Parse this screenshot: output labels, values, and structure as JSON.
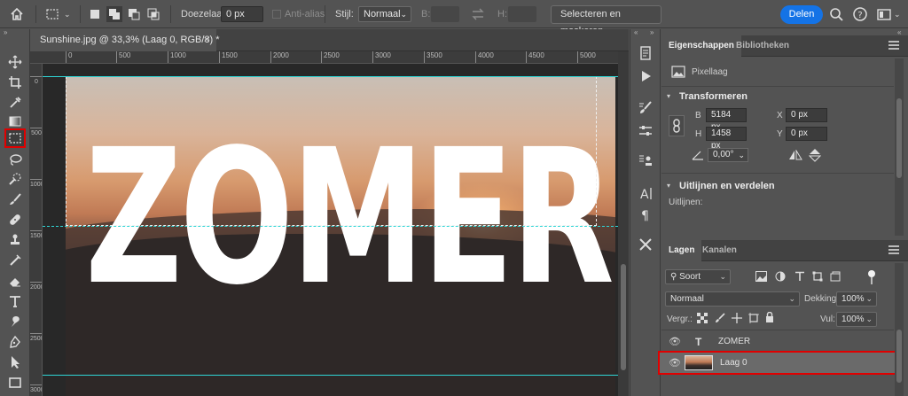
{
  "options_bar": {
    "feather_label": "Doezelaar:",
    "feather_value": "0 px",
    "antialias_label": "Anti-alias",
    "style_label": "Stijl:",
    "style_value": "Normaal",
    "width_label": "B:",
    "height_label": "H:",
    "select_mask_label": "Selecteren en maskeren...",
    "share_label": "Delen"
  },
  "document": {
    "tab_title": "Sunshine.jpg @ 33,3% (Laag 0, RGB/8) *",
    "close_glyph": "×",
    "image_text": "ZOMER"
  },
  "ruler": {
    "top": [
      "0",
      "500",
      "1000",
      "1500",
      "2000",
      "2500",
      "3000",
      "3500",
      "4000",
      "4500",
      "5000"
    ],
    "left": [
      "0",
      "500",
      "1000",
      "1500",
      "2000",
      "2500",
      "3000"
    ]
  },
  "toolbar": {
    "tools": [
      "move-icon",
      "crop-icon",
      "eyedropper-icon",
      "gradient-icon",
      "rectangular-marquee-icon",
      "lasso-icon",
      "quick-selection-icon",
      "brush-icon",
      "healing-brush-icon",
      "clone-stamp-icon",
      "eraser-icon",
      "type-icon",
      "smudge-icon",
      "pen-icon",
      "path-selection-icon",
      "rectangle-shape-icon"
    ],
    "active_tool": "rectangular-marquee-icon"
  },
  "properties": {
    "tab_active": "Eigenschappen",
    "tab_other": "Bibliotheken",
    "layer_type": "Pixellaag",
    "transform_heading": "Transformeren",
    "w_label": "B",
    "w_value": "5184 px",
    "h_label": "H",
    "h_value": "1458 px",
    "x_label": "X",
    "x_value": "0 px",
    "y_label": "Y",
    "y_value": "0 px",
    "angle_value": "0,00°",
    "align_heading": "Uitlijnen en verdelen",
    "align_label": "Uitlijnen:"
  },
  "layers": {
    "tab_active": "Lagen",
    "tab_other": "Kanalen",
    "filter_label": "Soort",
    "blend_mode": "Normaal",
    "opacity_label": "Dekking:",
    "opacity_value": "100%",
    "lock_label": "Vergr.:",
    "fill_label": "Vul:",
    "fill_value": "100%",
    "items": [
      {
        "name": "ZOMER",
        "kind": "text"
      },
      {
        "name": "Laag 0",
        "kind": "pixel"
      }
    ]
  },
  "colors": {
    "accent": "#1473e6",
    "highlight": "#e00000",
    "guide": "#2fd6d6"
  }
}
